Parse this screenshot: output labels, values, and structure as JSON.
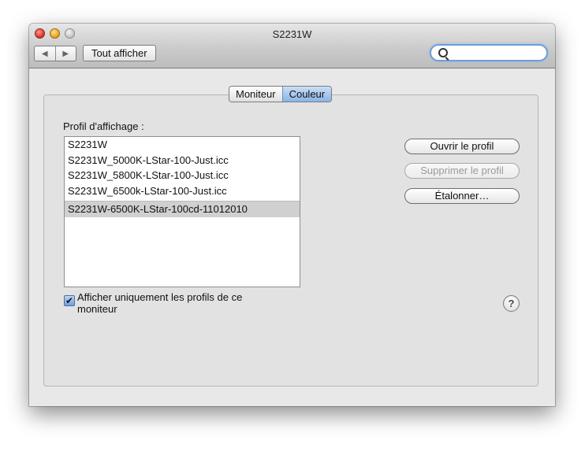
{
  "window": {
    "title": "S2231W"
  },
  "toolbar": {
    "back_glyph": "◀",
    "forward_glyph": "▶",
    "show_all_label": "Tout afficher",
    "search_value": "",
    "search_icon": "magnifier-icon"
  },
  "tabs": [
    {
      "label": "Moniteur",
      "selected": false
    },
    {
      "label": "Couleur",
      "selected": true
    }
  ],
  "profiles": {
    "label": "Profil d'affichage :",
    "items": [
      {
        "label": "S2231W",
        "selected": false
      },
      {
        "label": "S2231W_5000K-LStar-100-Just.icc",
        "selected": false
      },
      {
        "label": "S2231W_5800K-LStar-100-Just.icc",
        "selected": false
      },
      {
        "label": "S2231W_6500k-LStar-100-Just.icc",
        "selected": false
      },
      {
        "label": "S2231W-6500K-LStar-100cd-11012010",
        "selected": true
      }
    ]
  },
  "actions": {
    "open_profile": "Ouvrir le profil",
    "delete_profile": "Supprimer le profil",
    "calibrate": "Étalonner…"
  },
  "filter": {
    "checked": true,
    "check_glyph": "✔",
    "label": "Afficher uniquement les profils de ce moniteur"
  },
  "help": {
    "glyph": "?"
  }
}
